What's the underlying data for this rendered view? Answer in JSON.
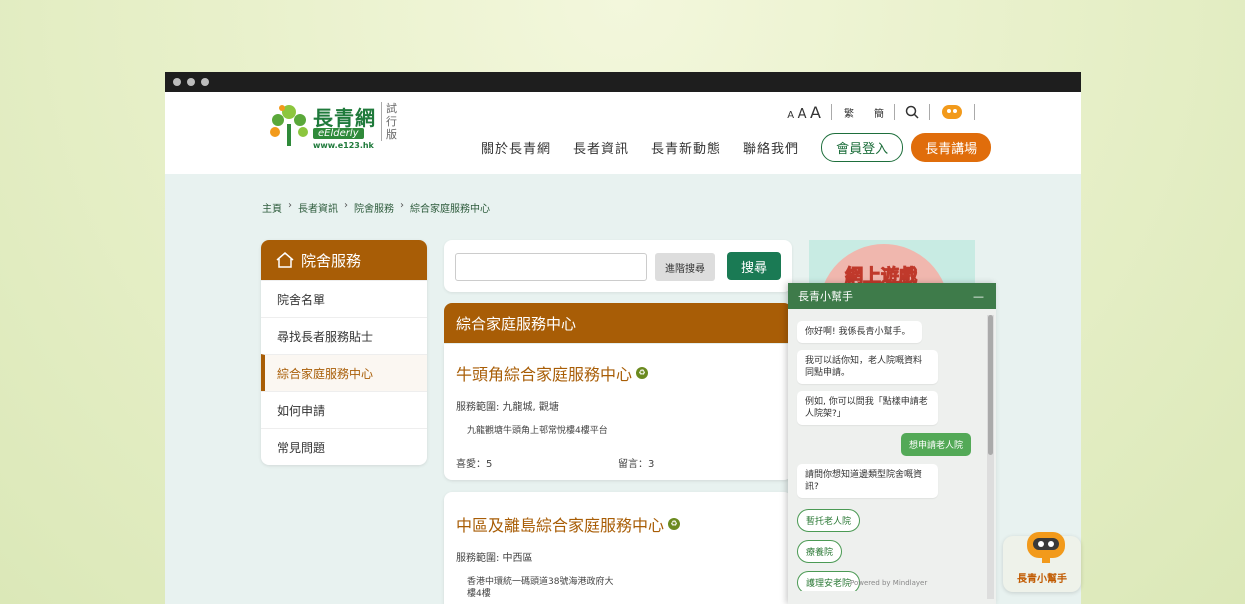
{
  "header": {
    "logo_cn": "長青網",
    "logo_en": "eElderly",
    "logo_url": "www.e123.hk",
    "trial": "試行版",
    "font_sizes": [
      "A",
      "A",
      "A"
    ],
    "lang_trad": "繁",
    "lang_simp": "簡",
    "nav": [
      "關於長青網",
      "長者資訊",
      "長青新動態",
      "聯絡我們"
    ],
    "login": "會員登入",
    "forum": "長青講場"
  },
  "breadcrumb": [
    "主頁",
    "長者資訊",
    "院舍服務",
    "綜合家庭服務中心"
  ],
  "sidebar": {
    "title": "院舍服務",
    "items": [
      "院舍名單",
      "尋找長者服務貼士",
      "綜合家庭服務中心",
      "如何申請",
      "常見問題"
    ],
    "active_index": 2
  },
  "search": {
    "placeholder": "",
    "advanced": "進階搜尋",
    "button": "搜尋"
  },
  "section": {
    "title": "綜合家庭服務中心"
  },
  "cards": [
    {
      "title": "牛頭角綜合家庭服務中心",
      "scope": "服務範圍: 九龍城, 觀塘",
      "address": "九龍觀塘牛頭角上邨常悅樓4樓平台",
      "likes": "喜愛：5",
      "comments": "留言：3"
    },
    {
      "title": "中區及離島綜合家庭服務中心",
      "scope": "服務範圍: 中西區",
      "address": "香港中環統一碼頭道38號海港政府大樓4樓"
    }
  ],
  "ad": {
    "text": "網上遊戲"
  },
  "chat": {
    "title": "長青小幫手",
    "minimize": "—",
    "messages": [
      "你好啊! 我係長青小幫手。",
      "我可以話你知，老人院嘅資料同點申請。",
      "例如, 你可以問我「點樣申請老人院架?」"
    ],
    "user_message": "想申請老人院",
    "question": "請問你想知道邊類型院舍嘅資訊?",
    "chips": [
      "暫托老人院",
      "療養院",
      "護理安老院"
    ],
    "powered": "Powered by Mindlayer"
  },
  "helper": {
    "label": "長青小幫手"
  },
  "colors": {
    "brown": "#a85d06",
    "green": "#1a7a54",
    "orange": "#e06d0b"
  }
}
